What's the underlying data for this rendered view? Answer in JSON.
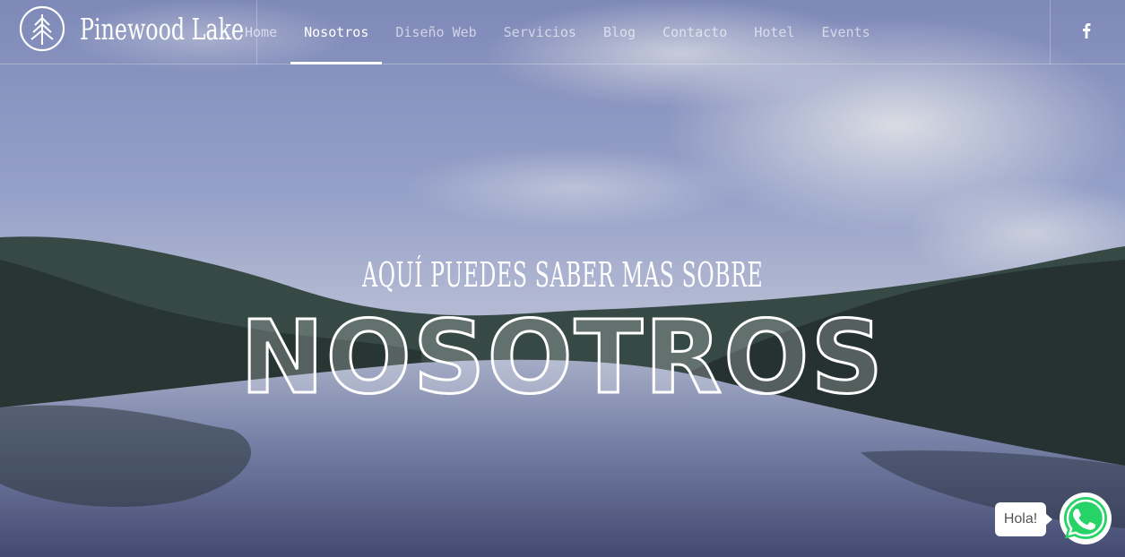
{
  "brand": {
    "name": "Pinewood Lake"
  },
  "nav": {
    "items": [
      {
        "label": "Home"
      },
      {
        "label": "Nosotros"
      },
      {
        "label": "Diseño Web"
      },
      {
        "label": "Servicios"
      },
      {
        "label": "Blog"
      },
      {
        "label": "Contacto"
      },
      {
        "label": "Hotel"
      },
      {
        "label": "Events"
      }
    ],
    "active": "Nosotros"
  },
  "social": {
    "icon": "facebook-icon"
  },
  "hero": {
    "subtitle": "Aquí puedes saber mas sobre",
    "title": "Nosotros"
  },
  "chat": {
    "greeting": "Hola!",
    "icon": "whatsapp-icon",
    "color": "#25d366"
  },
  "colors": {
    "text": "#ffffff",
    "nav_inactive": "rgba(255,255,255,0.62)"
  }
}
